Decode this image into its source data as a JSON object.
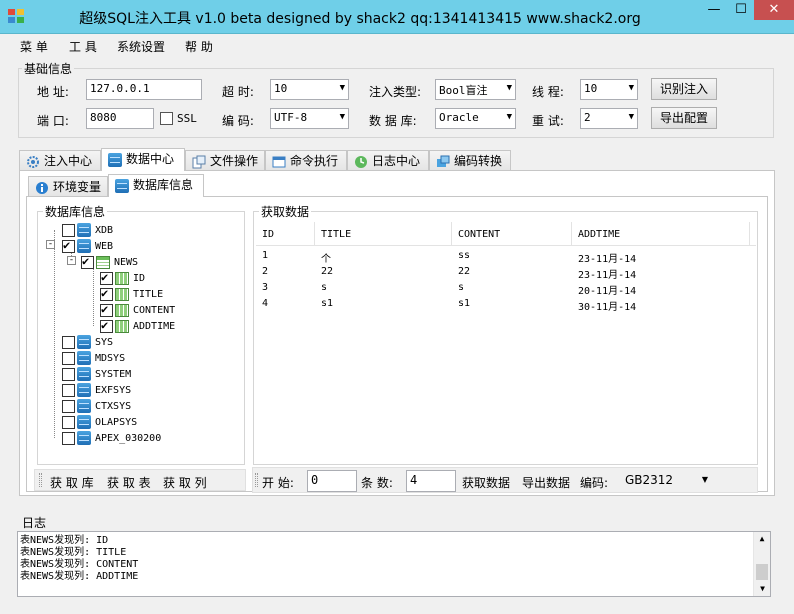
{
  "window": {
    "title": "超级SQL注入工具 v1.0 beta designed by shack2 qq:1341413415 www.shack2.org",
    "min": "—",
    "max": "☐",
    "close": "✕"
  },
  "menu": [
    "菜 单",
    "工 具",
    "系统设置",
    "帮 助"
  ],
  "basic": {
    "title": "基础信息",
    "address_label": "地 址:",
    "address": "127.0.0.1",
    "port_label": "端 口:",
    "port": "8080",
    "ssl_label": "SSL",
    "timeout_label": "超 时:",
    "timeout": "10",
    "encoding_label": "编 码:",
    "encoding": "UTF-8",
    "inject_type_label": "注入类型:",
    "inject_type": "Bool盲注",
    "database_label": "数 据 库:",
    "database": "Oracle",
    "threads_label": "线 程:",
    "threads": "10",
    "retry_label": "重 试:",
    "retry": "2",
    "identify_button": "识别注入",
    "export_config_button": "导出配置"
  },
  "tabs": [
    "注入中心",
    "数据中心",
    "文件操作",
    "命令执行",
    "日志中心",
    "编码转换"
  ],
  "subtabs": [
    "环境变量",
    "数据库信息"
  ],
  "dbinfo": {
    "title": "数据库信息",
    "tree": [
      {
        "label": "XDB",
        "checked": false
      },
      {
        "label": "WEB",
        "checked": true
      },
      {
        "label": "NEWS",
        "checked": true
      },
      {
        "label": "ID",
        "checked": true
      },
      {
        "label": "TITLE",
        "checked": true
      },
      {
        "label": "CONTENT",
        "checked": true
      },
      {
        "label": "ADDTIME",
        "checked": true
      },
      {
        "label": "SYS",
        "checked": false
      },
      {
        "label": "MDSYS",
        "checked": false
      },
      {
        "label": "SYSTEM",
        "checked": false
      },
      {
        "label": "EXFSYS",
        "checked": false
      },
      {
        "label": "CTXSYS",
        "checked": false
      },
      {
        "label": "OLAPSYS",
        "checked": false
      },
      {
        "label": "APEX_030200",
        "checked": false
      }
    ],
    "get_db_button": "获 取 库",
    "get_table_button": "获 取 表",
    "get_column_button": "获 取 列"
  },
  "fetch": {
    "title": "获取数据",
    "columns": [
      "ID",
      "TITLE",
      "CONTENT",
      "ADDTIME"
    ],
    "rows": [
      [
        "1",
        "个",
        "ss",
        "23-11月-14"
      ],
      [
        "2",
        "22",
        "22",
        "23-11月-14"
      ],
      [
        "3",
        "s",
        "s",
        "20-11月-14"
      ],
      [
        "4",
        "s1",
        "s1",
        "30-11月-14"
      ]
    ],
    "start_label": "开 始:",
    "start": "0",
    "count_label": "条 数:",
    "count": "4",
    "fetch_button": "获取数据",
    "export_button": "导出数据",
    "encoding_label": "编码:",
    "encoding": "GB2312"
  },
  "log": {
    "title": "日志",
    "lines": [
      "表NEWS发现列: ID",
      "表NEWS发现列: TITLE",
      "表NEWS发现列: CONTENT",
      "表NEWS发现列: ADDTIME"
    ]
  }
}
